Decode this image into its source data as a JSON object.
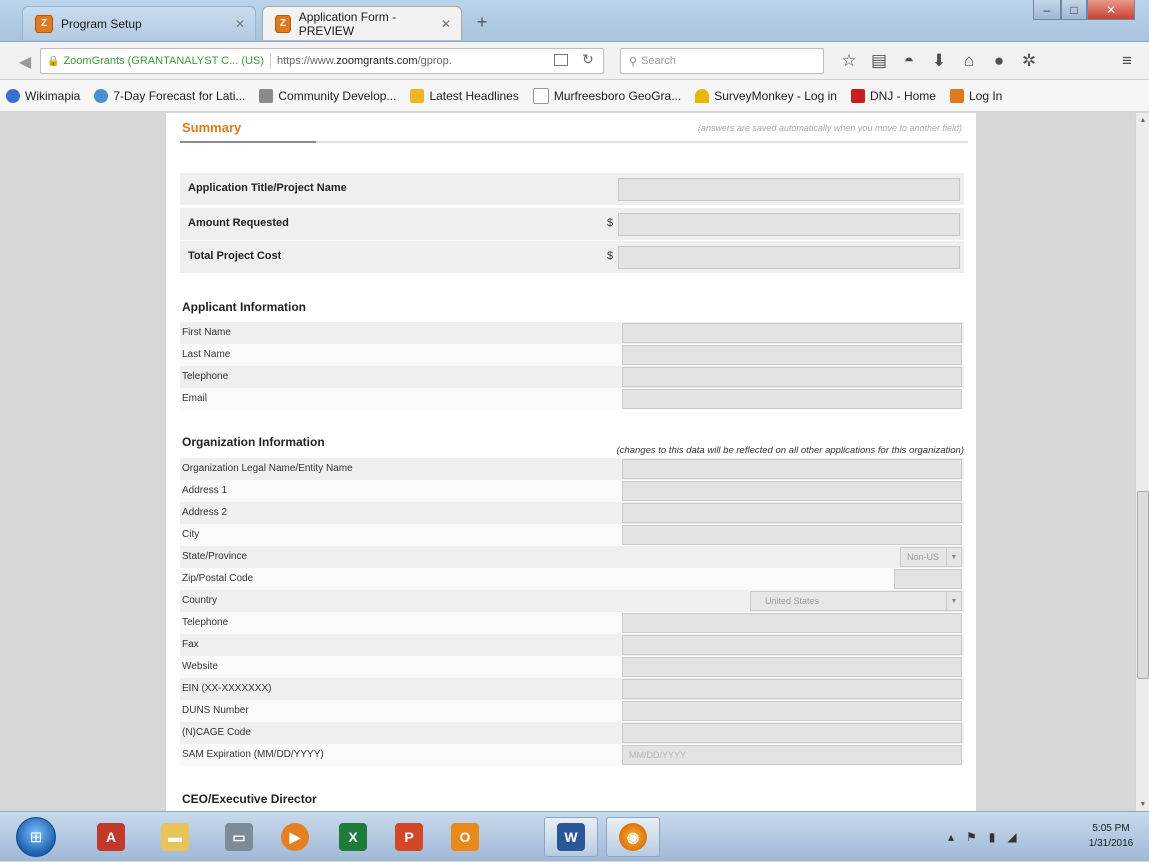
{
  "browser": {
    "tabs": [
      {
        "label": "Program Setup",
        "active": false
      },
      {
        "label": "Application Form - PREVIEW",
        "active": true
      }
    ],
    "identity": "ZoomGrants (GRANTANALYST C... (US)",
    "url_prefix": "https://www.",
    "url_domain": "zoomgrants.com",
    "url_suffix": "/gprop.",
    "search_placeholder": "Search",
    "bookmarks": [
      "Wikimapia",
      "7-Day Forecast for Lati...",
      "Community Develop...",
      "Latest Headlines",
      "Murfreesboro GeoGra...",
      "SurveyMonkey - Log in",
      "DNJ - Home",
      "Log In"
    ]
  },
  "summary": {
    "title": "Summary",
    "note": "(answers are saved automatically when you move to another field)",
    "rows": [
      {
        "label": "Application Title/Project Name",
        "prefix": ""
      },
      {
        "label": "Amount Requested",
        "prefix": "$"
      },
      {
        "label": "Total Project Cost",
        "prefix": "$"
      }
    ]
  },
  "applicant": {
    "title": "Applicant Information",
    "fields": [
      "First Name",
      "Last Name",
      "Telephone",
      "Email"
    ]
  },
  "organization": {
    "title": "Organization Information",
    "note": "(changes to this data will be reflected on all other applications for this organization)",
    "fields": [
      "Organization Legal Name/Entity Name",
      "Address 1",
      "Address 2",
      "City",
      "State/Province",
      "Zip/Postal Code",
      "Country",
      "Telephone",
      "Fax",
      "Website",
      "EIN (XX-XXXXXXX)",
      "DUNS Number",
      "(N)CAGE Code",
      "SAM Expiration (MM/DD/YYYY)"
    ],
    "state_value": "Non-US",
    "country_value": "United States",
    "sam_placeholder": "MM/DD/YYYY"
  },
  "ceo": {
    "title": "CEO/Executive Director"
  },
  "taskbar": {
    "time": "5:05 PM",
    "date": "1/31/2016"
  }
}
